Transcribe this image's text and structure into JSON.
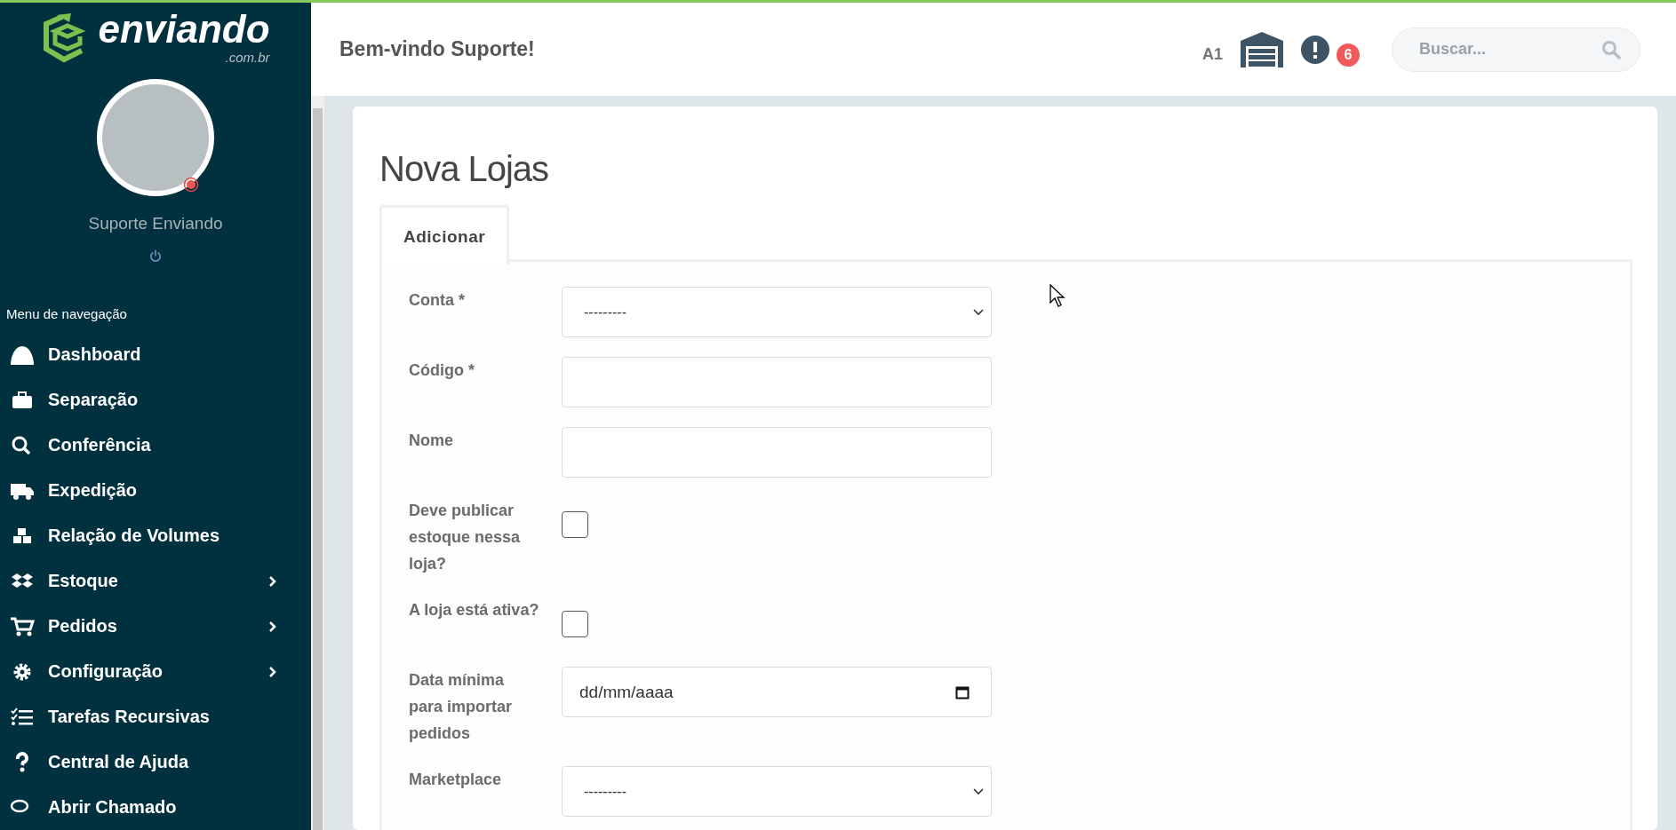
{
  "sidebar": {
    "logo": {
      "name": "enviando",
      "suffix": ".com.br"
    },
    "user": {
      "name": "Suporte Enviando"
    },
    "menu_title": "Menu de navegação",
    "items": [
      {
        "label": "Dashboard",
        "submenu": false
      },
      {
        "label": "Separação",
        "submenu": false
      },
      {
        "label": "Conferência",
        "submenu": false
      },
      {
        "label": "Expedição",
        "submenu": false
      },
      {
        "label": "Relação de Volumes",
        "submenu": false
      },
      {
        "label": "Estoque",
        "submenu": true
      },
      {
        "label": "Pedidos",
        "submenu": true
      },
      {
        "label": "Configuração",
        "submenu": true
      },
      {
        "label": "Tarefas Recursivas",
        "submenu": false
      },
      {
        "label": "Central de Ajuda",
        "submenu": false
      },
      {
        "label": "Abrir Chamado",
        "submenu": false
      }
    ]
  },
  "header": {
    "greeting": "Bem-vindo Suporte!",
    "warehouse_code": "A1",
    "notification_count": "6",
    "search": {
      "placeholder": "Buscar..."
    }
  },
  "page": {
    "title": "Nova Lojas",
    "tabs": [
      {
        "label": "Adicionar",
        "selected": true
      }
    ],
    "fields": [
      {
        "kind": "select",
        "label": "Conta *",
        "value": "---------"
      },
      {
        "kind": "text",
        "label": "Código *"
      },
      {
        "kind": "text",
        "label": "Nome"
      },
      {
        "kind": "checkbox",
        "label": "Deve publicar estoque nessa loja?",
        "checked": false
      },
      {
        "kind": "checkbox",
        "label": "A loja está ativa?",
        "checked": false
      },
      {
        "kind": "date",
        "label": "Data mínima para importar pedidos",
        "placeholder": "dd/mm/aaaa"
      },
      {
        "kind": "select",
        "label": "Marketplace",
        "value": "---------"
      }
    ]
  }
}
